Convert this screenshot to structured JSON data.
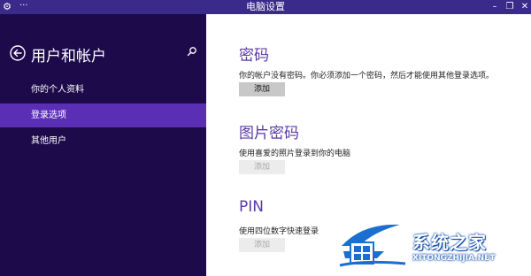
{
  "window": {
    "title": "电脑设置",
    "menu_label": "···",
    "minimize_label": "–",
    "maximize_label": "❐",
    "close_label": "✕"
  },
  "sidebar": {
    "heading": "用户和帐户",
    "items": [
      {
        "label": "你的个人资料",
        "selected": false
      },
      {
        "label": "登录选项",
        "selected": true
      },
      {
        "label": "其他用户",
        "selected": false
      }
    ]
  },
  "main": {
    "sections": [
      {
        "title": "密码",
        "description": "你的帐户没有密码。你必须添加一个密码，然后才能使用其他登录选项。",
        "button": "添加",
        "button_enabled": true
      },
      {
        "title": "图片密码",
        "description": "使用喜爱的照片登录到你的电脑",
        "button": "添加",
        "button_enabled": false
      },
      {
        "title": "PIN",
        "description": "使用四位数字快速登录",
        "button": "添加",
        "button_enabled": false
      }
    ]
  },
  "watermark": {
    "name": "系统之家",
    "url": "XITONGZHIJIA.NET"
  },
  "colors": {
    "titlebar": "#3a2a8a",
    "sidebar": "#1c0a4a",
    "selected": "#5b2fb5",
    "section_title": "#5a3aa8"
  },
  "icons": [
    "app-gear-icon",
    "back-arrow-icon",
    "search-icon",
    "watermark-logo-icon"
  ]
}
